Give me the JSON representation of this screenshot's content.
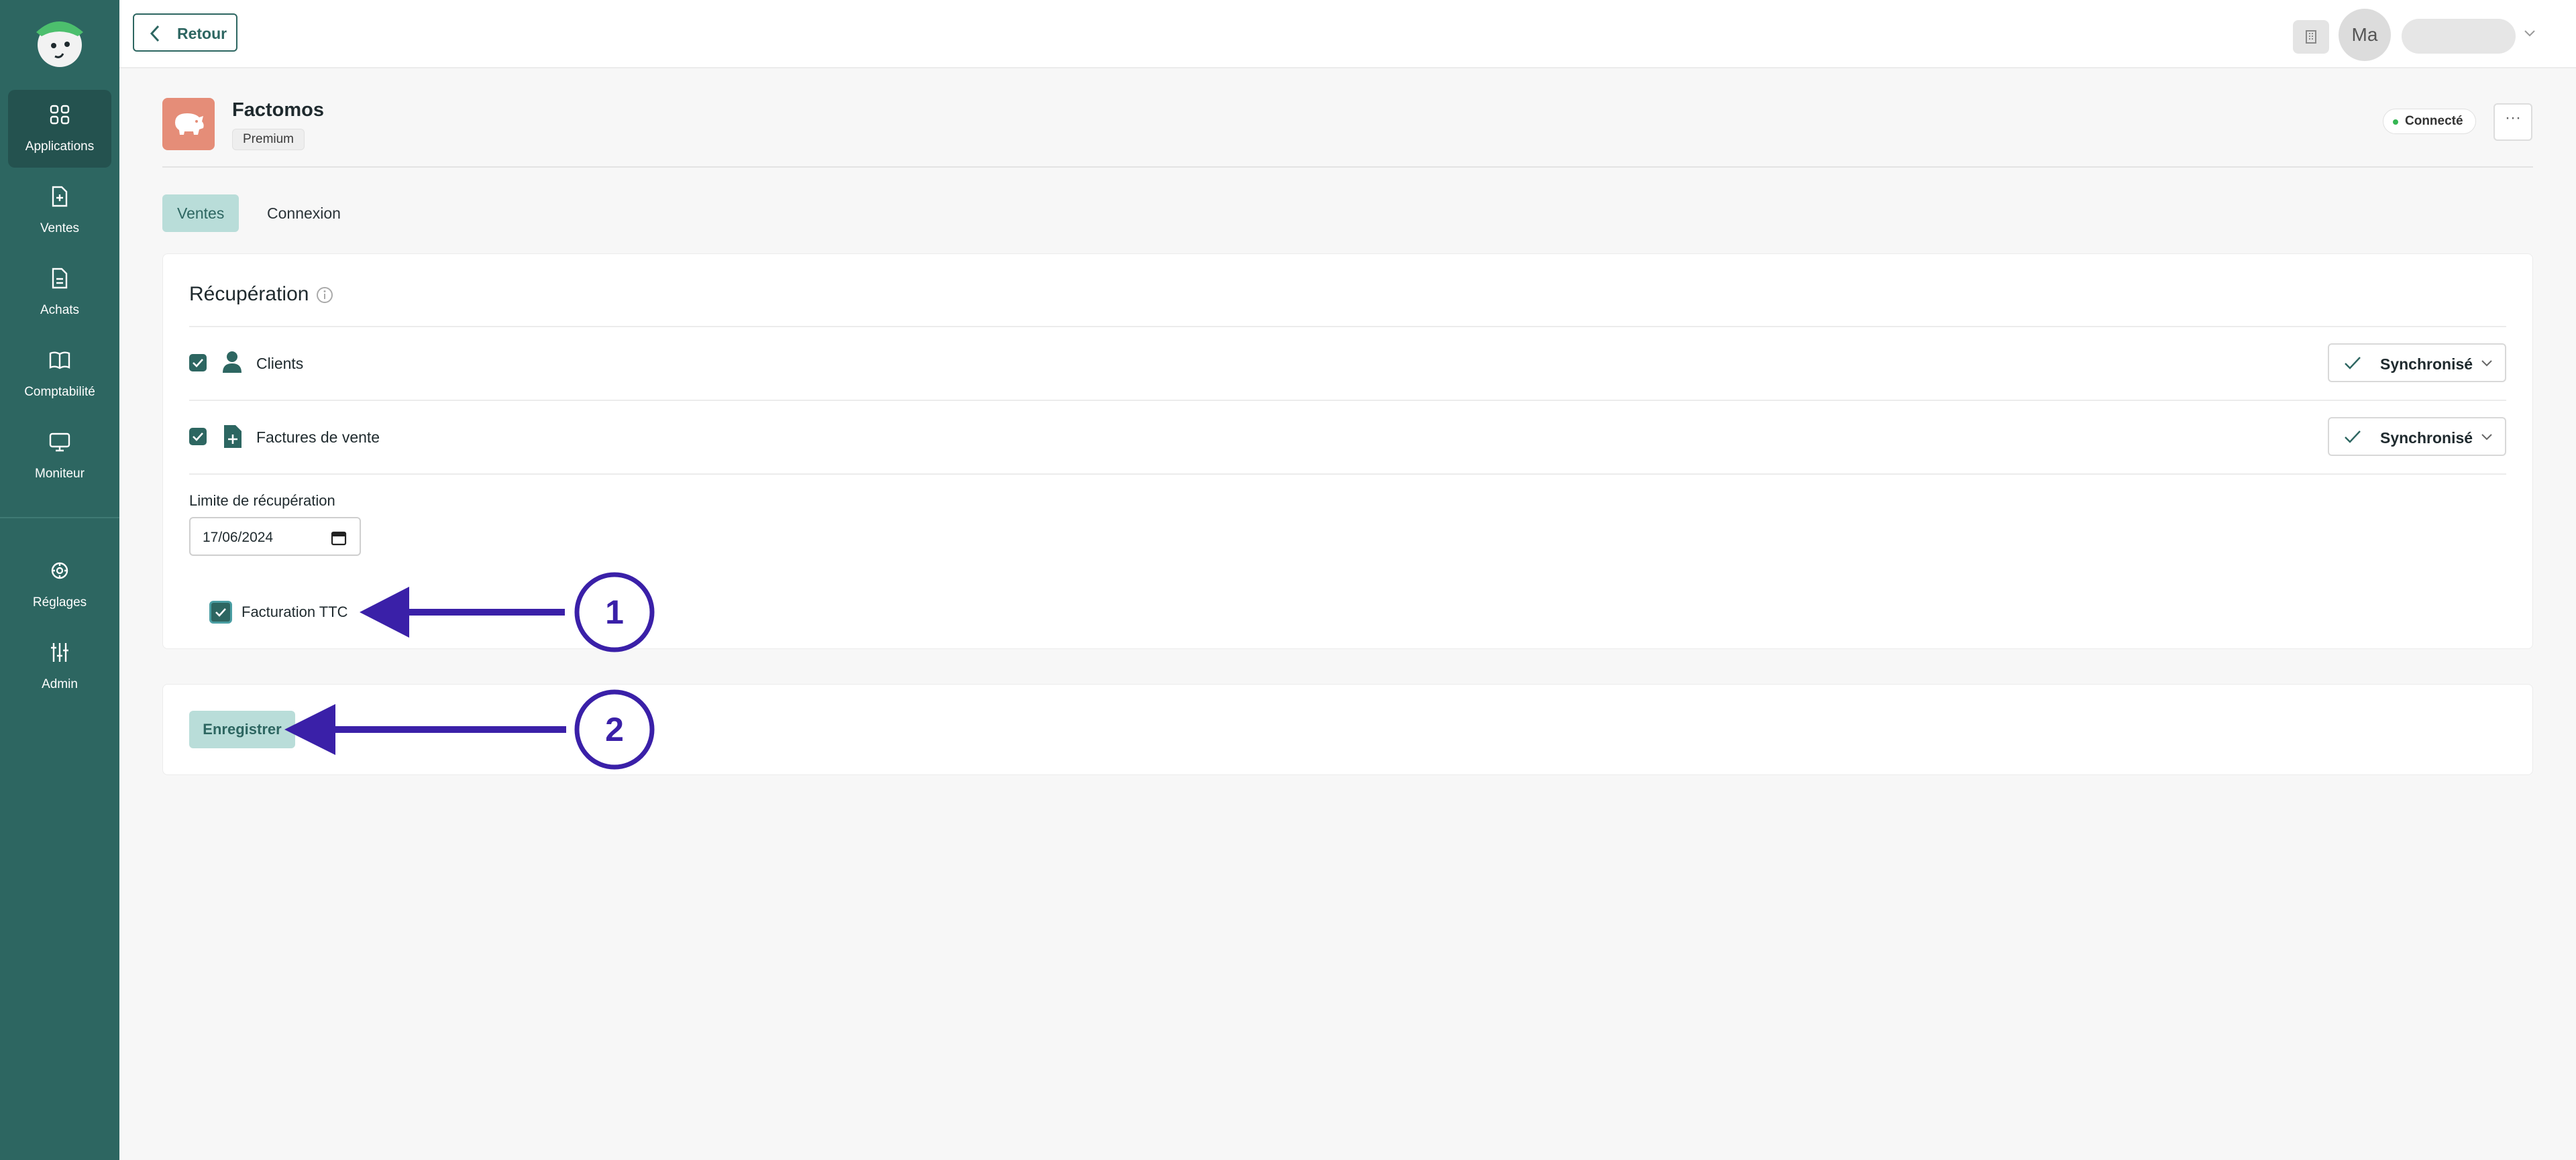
{
  "sidebar": {
    "items": [
      {
        "label": "Applications",
        "icon": "grid-icon",
        "active": true
      },
      {
        "label": "Ventes",
        "icon": "file-plus-icon"
      },
      {
        "label": "Achats",
        "icon": "file-text-icon"
      },
      {
        "label": "Comptabilité",
        "icon": "book-icon"
      },
      {
        "label": "Moniteur",
        "icon": "monitor-icon"
      },
      {
        "label": "Réglages",
        "icon": "gear-icon"
      },
      {
        "label": "Admin",
        "icon": "sliders-icon"
      }
    ]
  },
  "topbar": {
    "back_label": "Retour",
    "avatar_initials": "Ma"
  },
  "app": {
    "name": "Factomos",
    "plan": "Premium",
    "status": "Connecté",
    "more_label": "···"
  },
  "tabs": [
    {
      "label": "Ventes",
      "active": true
    },
    {
      "label": "Connexion",
      "active": false
    }
  ],
  "recuperation": {
    "title": "Récupération",
    "rows": [
      {
        "label": "Clients",
        "checked": true,
        "status": "Synchronisé"
      },
      {
        "label": "Factures de vente",
        "checked": true,
        "status": "Synchronisé"
      }
    ],
    "limit_label": "Limite de récupération",
    "limit_value": "17/06/2024",
    "ttc_label": "Facturation TTC",
    "ttc_checked": true
  },
  "save_label": "Enregistrer",
  "annotations": {
    "step1": "1",
    "step2": "2"
  },
  "colors": {
    "sidebar": "#2d6661",
    "accent_light": "#b9ddd9",
    "status_green": "#35b653",
    "annotation": "#3a20a8",
    "app_icon": "#e58d78"
  }
}
